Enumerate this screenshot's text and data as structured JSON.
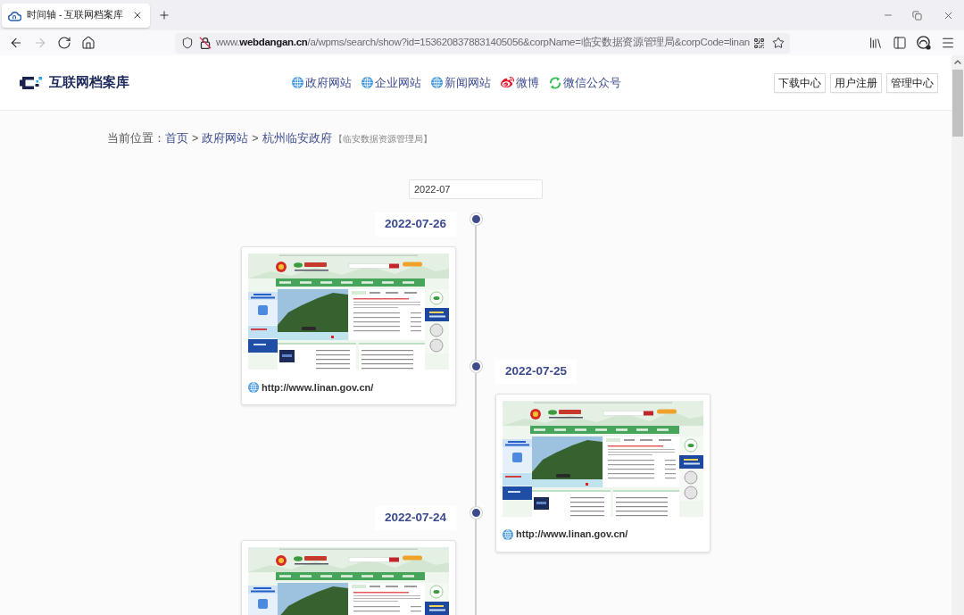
{
  "browser": {
    "tab": {
      "title": "时间轴 - 互联网档案库",
      "selected": true
    },
    "nav_buttons": [
      {
        "kind": "back",
        "disabled": false
      },
      {
        "kind": "forward",
        "disabled": true
      },
      {
        "kind": "reload",
        "disabled": false
      },
      {
        "kind": "home",
        "disabled": false
      }
    ],
    "address_bar": {
      "url": "www.**webdangan.cn**/a/wpms/search/show?id=1536208378831405056&corpName=临安数据资源管理局&corpCode=linan"
    }
  },
  "header": {
    "site_title": "互联网档案库",
    "nav_links": [
      {
        "kind": "globe",
        "label": "政府网站"
      },
      {
        "kind": "globe",
        "label": "企业网站"
      },
      {
        "kind": "globe",
        "label": "新闻网站"
      },
      {
        "kind": "weibo",
        "label": "微博"
      },
      {
        "kind": "wechat",
        "label": "微信公众号"
      }
    ],
    "buttons": [
      "下载中心",
      "用户注册",
      "管理中心"
    ]
  },
  "breadcrumb": {
    "label": "当前位置：",
    "path": [
      {
        "kind": "link",
        "text": "首页"
      },
      {
        "kind": "separator",
        "text": ">"
      },
      {
        "kind": "link",
        "text": "政府网站"
      },
      {
        "kind": "separator",
        "text": ">"
      },
      {
        "kind": "link",
        "text": "杭州临安政府"
      }
    ],
    "note": "【临安数据资源管理局】"
  },
  "month_field": {
    "value": "2022-07"
  },
  "timeline": [
    {
      "date": "2022-07-26",
      "url": "http://www.linan.gov.cn/"
    },
    {
      "date": "2022-07-25",
      "url": "http://www.linan.gov.cn/"
    },
    {
      "date": "2022-07-24"
    }
  ]
}
